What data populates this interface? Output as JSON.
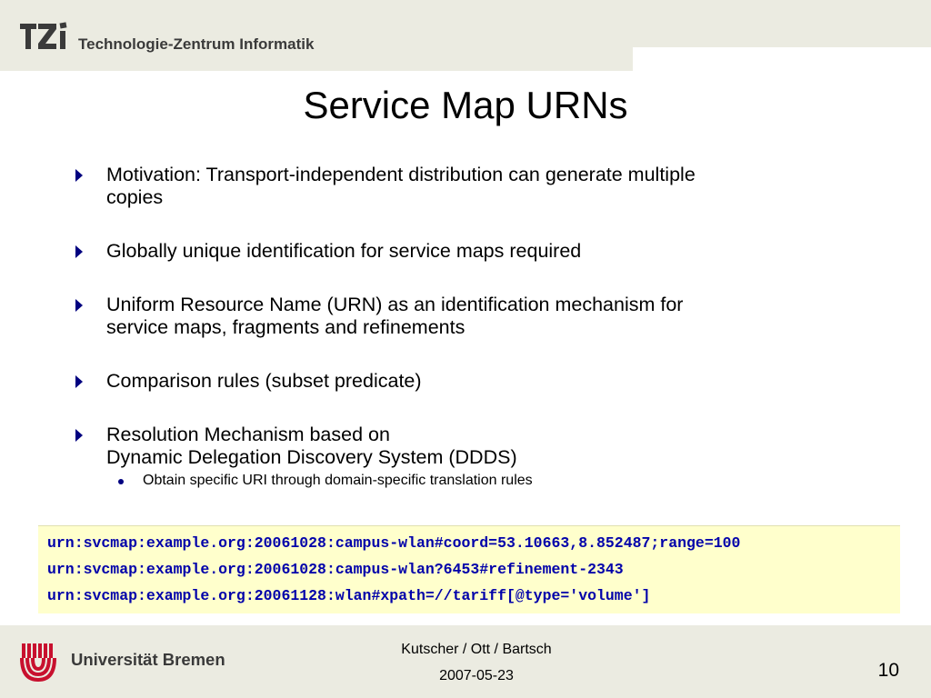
{
  "header": {
    "logo_text": "TZi",
    "institute_name": "Technologie-Zentrum Informatik"
  },
  "slide": {
    "title": "Service Map URNs",
    "bullets": [
      {
        "lines": [
          "Motivation: Transport-independent distribution can generate multiple",
          "copies"
        ]
      },
      {
        "lines": [
          "Globally unique identification for service maps required"
        ]
      },
      {
        "lines": [
          "Uniform Resource Name (URN) as an identification mechanism for",
          "service maps, fragments and refinements"
        ]
      },
      {
        "lines": [
          "Comparison rules (subset predicate)"
        ]
      },
      {
        "lines": [
          "Resolution Mechanism based on",
          "Dynamic Delegation Discovery System (DDDS)"
        ]
      }
    ],
    "sub_bullet": "Obtain specific URI through domain-specific translation rules",
    "urn_examples": [
      "urn:svcmap:example.org:20061028:campus-wlan#coord=53.10663,8.852487;range=100",
      "urn:svcmap:example.org:20061028:campus-wlan?6453#refinement-2343",
      "urn:svcmap:example.org:20061128:wlan#xpath=//tariff[@type='volume']"
    ]
  },
  "footer": {
    "university": "Universität Bremen",
    "authors": "Kutscher / Ott / Bartsch",
    "date": "2007-05-23",
    "page_number": "10"
  },
  "colors": {
    "accent": "#000080",
    "urn_text": "#0000aa",
    "urn_background": "#ffffcc",
    "band": "#ebebe1",
    "uni_red": "#c8102e"
  }
}
